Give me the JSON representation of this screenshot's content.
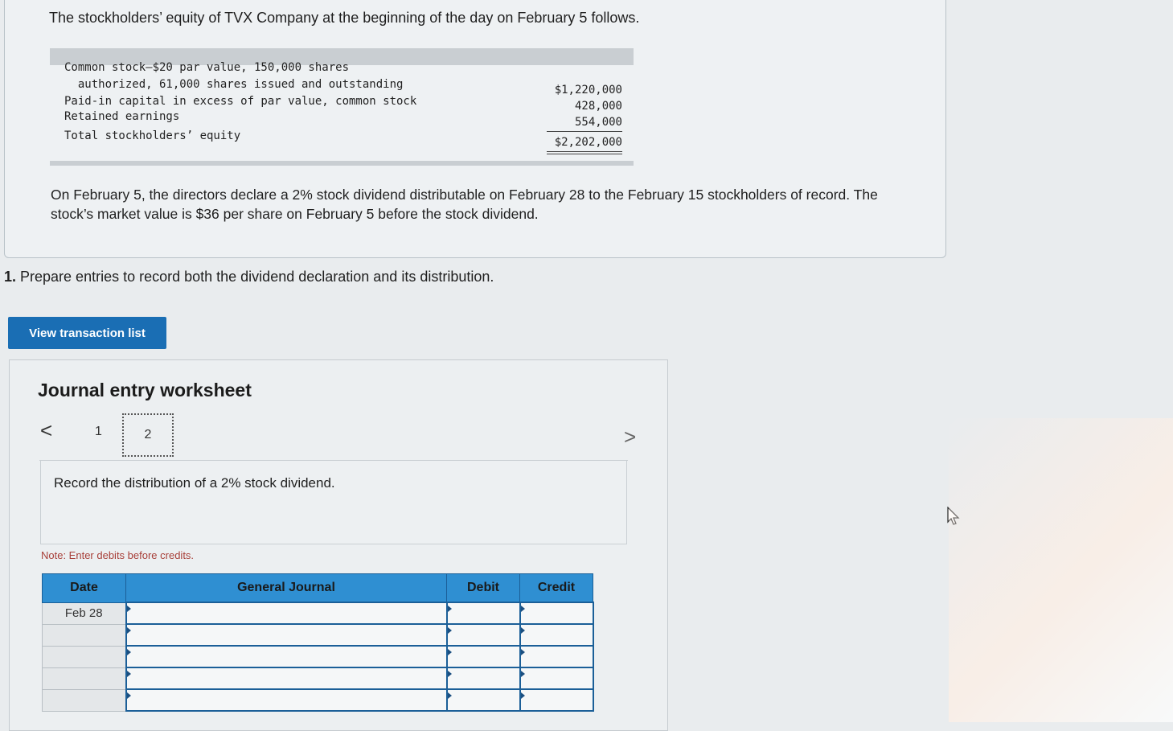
{
  "problem": {
    "intro": "The stockholders’ equity of TVX Company at the beginning of the day on February 5 follows.",
    "equity_lines": [
      "Common stock—$20 par value, 150,000 shares",
      "  authorized, 61,000 shares issued and outstanding",
      "Paid-in capital in excess of par value, common stock",
      "Retained earnings",
      "Total stockholders’ equity"
    ],
    "equity_amounts": [
      "$1,220,000",
      "428,000",
      "554,000",
      "$2,202,000"
    ],
    "paragraph": "On February 5, the directors declare a 2% stock dividend distributable on February 28 to the February 15 stockholders of record. The stock’s market value is $36 per share on February 5 before the stock dividend."
  },
  "question": {
    "number": "1.",
    "text": " Prepare entries to record both the dividend declaration and its distribution."
  },
  "buttons": {
    "view_transactions": "View transaction list"
  },
  "worksheet": {
    "title": "Journal entry worksheet",
    "nav_prev": "<",
    "nav_next": ">",
    "pages": [
      "1",
      "2"
    ],
    "instruction": "Record the distribution of a 2% stock dividend.",
    "note": "Note: Enter debits before credits.",
    "table": {
      "headers": [
        "Date",
        "General Journal",
        "Debit",
        "Credit"
      ],
      "rows": [
        {
          "date": "Feb 28"
        },
        {
          "date": ""
        },
        {
          "date": ""
        },
        {
          "date": ""
        },
        {
          "date": ""
        }
      ]
    }
  },
  "colors": {
    "button_blue": "#1a6eb4",
    "table_header_blue": "#2f8fd2",
    "note_red": "#a8403a"
  }
}
